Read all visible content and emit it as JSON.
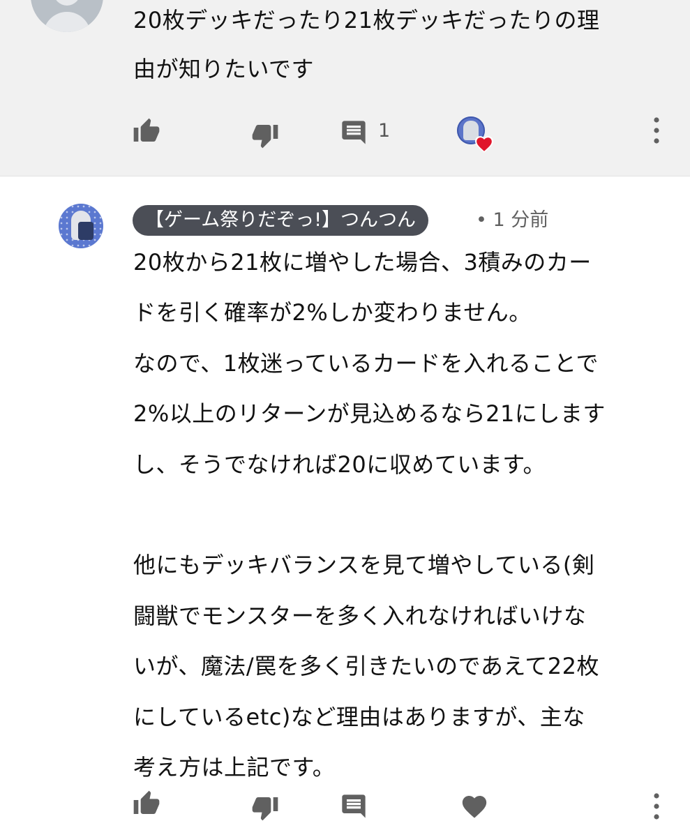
{
  "top_comment": {
    "text_lines": [
      "20枚デッキだったり21枚デッキだったりの理",
      "由が知りたいです"
    ],
    "reply_count": "1"
  },
  "reply": {
    "author": "【ゲーム祭りだぞっ!】つんつん",
    "time": "• 1 分前",
    "text_lines": [
      "20枚から21枚に増やした場合、3積みのカー",
      "ドを引く確率が2%しか変わりません。",
      "なので、1枚迷っているカードを入れることで",
      "2%以上のリターンが見込めるなら21にします",
      "し、そうでなければ20に収めています。",
      "",
      "他にもデッキバランスを見て増やしている(剣",
      "闘獣でモンスターを多く入れなければいけな",
      "いが、魔法/罠を多く引きたいのであえて22枚",
      "にしているetc)など理由はありますが、主な",
      "考え方は上記です。"
    ]
  },
  "icons": {
    "like": "thumb-up-icon",
    "dislike": "thumb-down-icon",
    "reply": "comment-icon",
    "heart": "heart-icon",
    "more": "more-vert-icon"
  },
  "colors": {
    "top_comment_bg": "#f1f1f1",
    "author_chip_bg": "#4b4e56",
    "heart_red": "#e0162b",
    "icon_grey": "#606060"
  }
}
